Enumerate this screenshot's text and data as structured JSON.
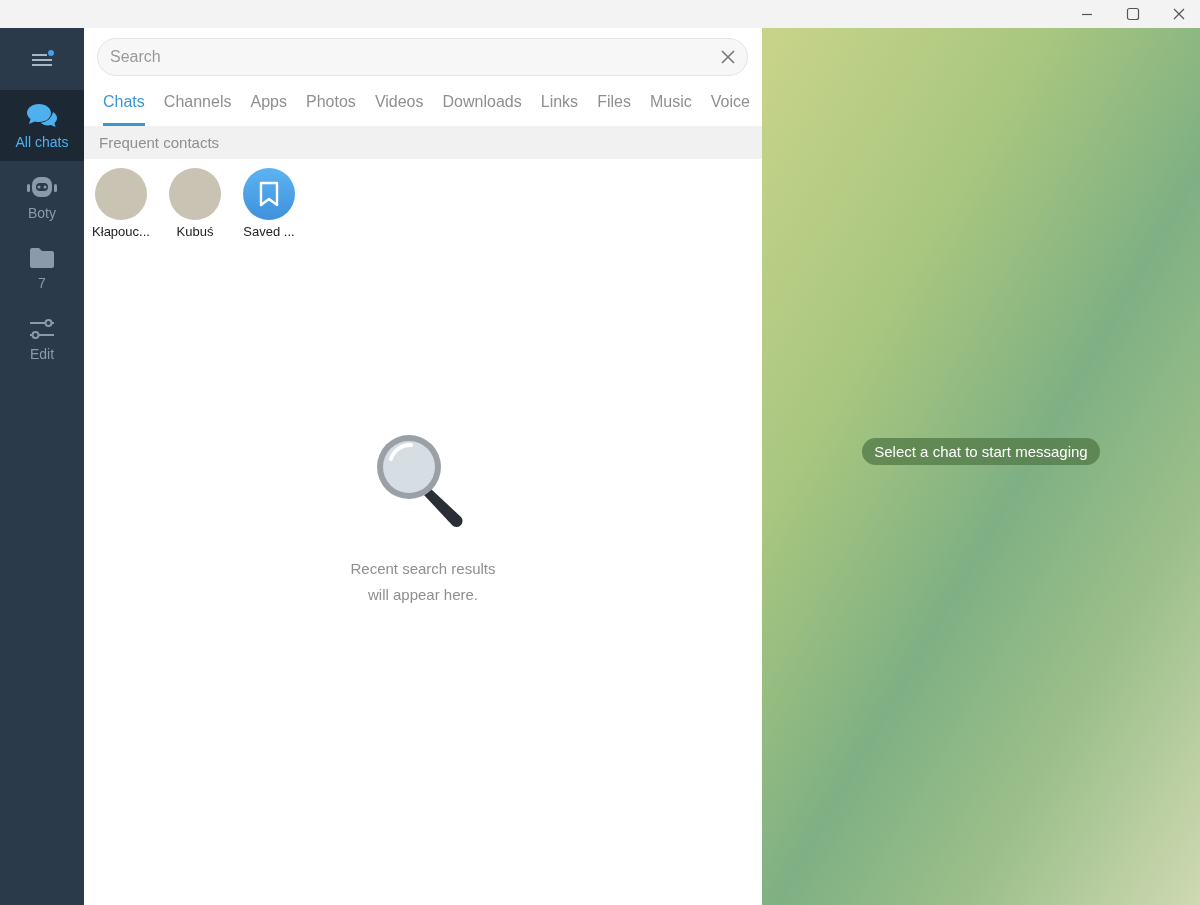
{
  "sidebar": {
    "menu_badge": true,
    "items": [
      {
        "kind": "chats",
        "label": "All chats",
        "selected": true
      },
      {
        "kind": "bot",
        "label": "Boty",
        "selected": false
      },
      {
        "kind": "folder",
        "label": "7",
        "selected": false
      },
      {
        "kind": "edit",
        "label": "Edit",
        "selected": false
      }
    ]
  },
  "search": {
    "placeholder": "Search"
  },
  "tabs": [
    {
      "label": "Chats",
      "selected": true
    },
    {
      "label": "Channels",
      "selected": false
    },
    {
      "label": "Apps",
      "selected": false
    },
    {
      "label": "Photos",
      "selected": false
    },
    {
      "label": "Videos",
      "selected": false
    },
    {
      "label": "Downloads",
      "selected": false
    },
    {
      "label": "Links",
      "selected": false
    },
    {
      "label": "Files",
      "selected": false
    },
    {
      "label": "Music",
      "selected": false
    },
    {
      "label": "Voice",
      "selected": false
    }
  ],
  "frequent_contacts": {
    "title": "Frequent contacts",
    "contacts": [
      {
        "kind": "photo",
        "name": "Kłapouc..."
      },
      {
        "kind": "photo",
        "name": "Kubuś"
      },
      {
        "kind": "saved",
        "name": "Saved ..."
      }
    ]
  },
  "empty_state": {
    "lines": [
      "Recent search results",
      "will appear here."
    ]
  },
  "chat_area": {
    "message": "Select a chat to start messaging"
  }
}
